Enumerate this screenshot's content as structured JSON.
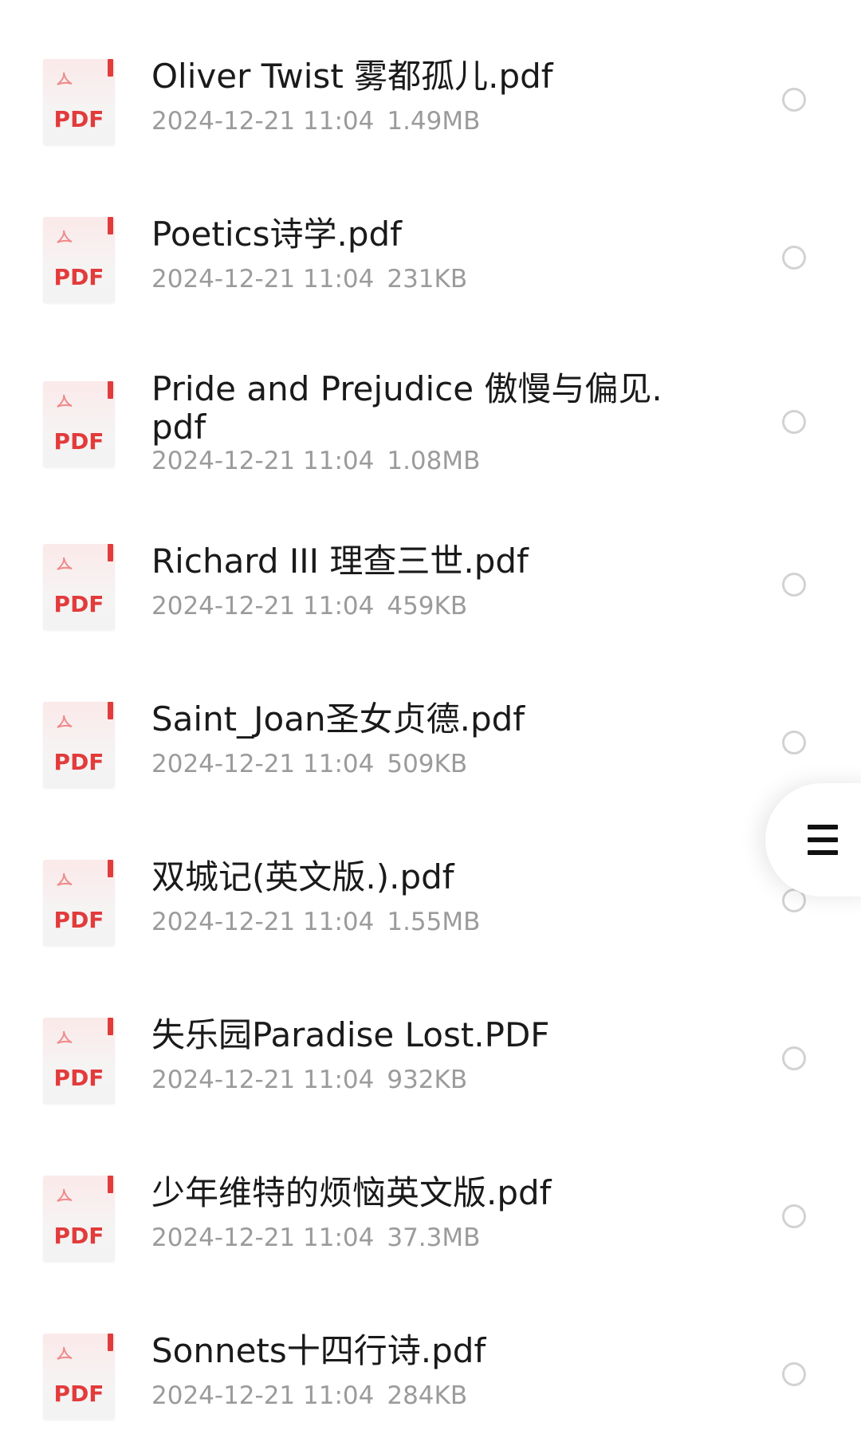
{
  "files": [
    {
      "name": "Oliver Twist 雾都孤儿.pdf",
      "date": "2024-12-21 11:04",
      "size": "1.49MB",
      "icon_label": "PDF"
    },
    {
      "name": "Poetics诗学.pdf",
      "date": "2024-12-21 11:04",
      "size": "231KB",
      "icon_label": "PDF"
    },
    {
      "name": "Pride and Prejudice 傲慢与偏见.pdf",
      "date": "2024-12-21 11:04",
      "size": "1.08MB",
      "icon_label": "PDF"
    },
    {
      "name": "Richard III 理查三世.pdf",
      "date": "2024-12-21 11:04",
      "size": "459KB",
      "icon_label": "PDF"
    },
    {
      "name": "Saint_Joan圣女贞德.pdf",
      "date": "2024-12-21 11:04",
      "size": "509KB",
      "icon_label": "PDF"
    },
    {
      "name": "双城记(英文版.).pdf",
      "date": "2024-12-21 11:04",
      "size": "1.55MB",
      "icon_label": "PDF"
    },
    {
      "name": "失乐园Paradise Lost.PDF",
      "date": "2024-12-21 11:04",
      "size": "932KB",
      "icon_label": "PDF"
    },
    {
      "name": "少年维特的烦恼英文版.pdf",
      "date": "2024-12-21 11:04",
      "size": "37.3MB",
      "icon_label": "PDF"
    },
    {
      "name": "Sonnets十四行诗.pdf",
      "date": "2024-12-21 11:04",
      "size": "284KB",
      "icon_label": "PDF"
    }
  ],
  "colors": {
    "pdf_red": "#e23b3b",
    "meta_gray": "#9b9b9b",
    "radio_border": "#d2d2d2"
  },
  "floating_menu": {
    "icon": "hamburger-menu-icon"
  }
}
